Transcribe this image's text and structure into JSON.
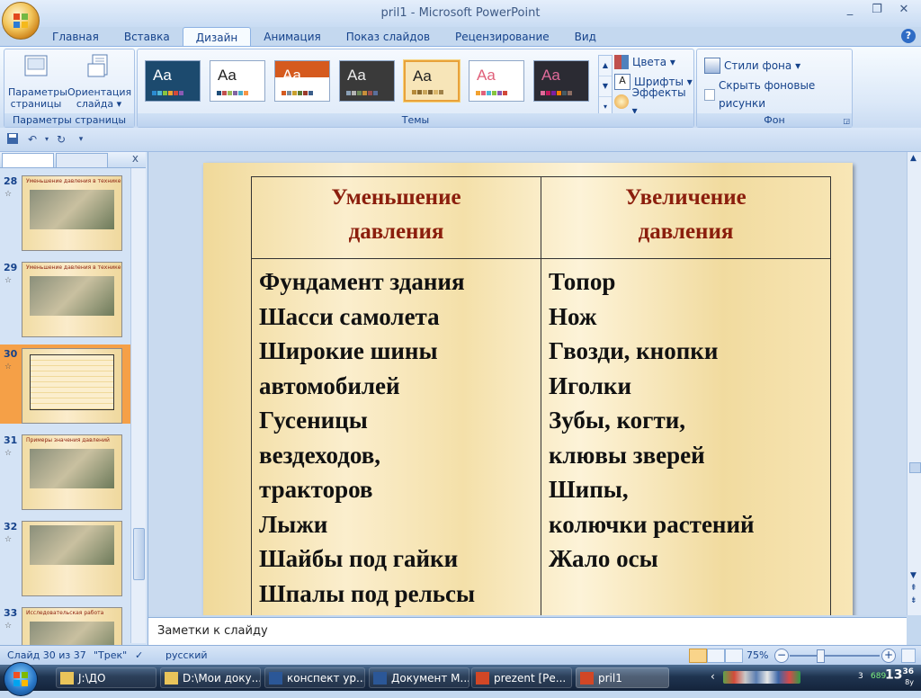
{
  "window": {
    "title": "pril1 - Microsoft PowerPoint",
    "controls": [
      "_",
      "❐",
      "✕"
    ]
  },
  "tabs": [
    "Главная",
    "Вставка",
    "Дизайн",
    "Анимация",
    "Показ слайдов",
    "Рецензирование",
    "Вид"
  ],
  "active_tab": "Дизайн",
  "ribbon": {
    "page_setup": {
      "params_label": "Параметры страницы",
      "orient_label": "Ориентация слайда ▾",
      "group_label": "Параметры страницы"
    },
    "themes": {
      "group_label": "Темы",
      "items": [
        {
          "aa": "Aa",
          "bg": "#1c4a6e",
          "fg": "#ffffff",
          "accents": [
            "#2b8bd0",
            "#4fb6d8",
            "#86c440",
            "#f2a230",
            "#d2483a",
            "#8a5ab4"
          ]
        },
        {
          "aa": "Aa",
          "bg": "#ffffff",
          "fg": "#222222",
          "accents": [
            "#1f4e79",
            "#c0504d",
            "#9bbb59",
            "#8064a2",
            "#4bacc6",
            "#f79646"
          ]
        },
        {
          "aa": "Aa",
          "bg": "#ffffff",
          "fg": "#ffffff",
          "accents": [
            "#d55a1e",
            "#7a8b9a",
            "#c8a02e",
            "#5c7a35",
            "#9a3b2b",
            "#3b5e8a"
          ]
        },
        {
          "aa": "Aa",
          "bg": "#3a3a3a",
          "fg": "#eeeeee",
          "accents": [
            "#8aa0b6",
            "#b3b3b3",
            "#6f8a5a",
            "#c98f3a",
            "#9b4f4f",
            "#5a6f9b"
          ]
        },
        {
          "aa": "Aa",
          "bg": "#f7e5b8",
          "fg": "#222222",
          "accents": [
            "#b58a3a",
            "#8a6a2e",
            "#c9a55a",
            "#7a5f30",
            "#d9b56a",
            "#a0824a"
          ]
        },
        {
          "aa": "Aa",
          "bg": "#ffffff",
          "fg": "#e0607a",
          "accents": [
            "#f2a230",
            "#e0607a",
            "#4fb6d8",
            "#86c440",
            "#8a5ab4",
            "#d2483a"
          ]
        },
        {
          "aa": "Aa",
          "bg": "#2b2b33",
          "fg": "#e06b9a",
          "accents": [
            "#e06b9a",
            "#c2185b",
            "#7b1fa2",
            "#f57c00",
            "#455a64",
            "#8d6e63"
          ]
        }
      ],
      "colors_label": "Цвета ▾",
      "fonts_label": "Шрифты ▾",
      "effects_label": "Эффекты ▾"
    },
    "background": {
      "styles_label": "Стили фона ▾",
      "hide_label": "Скрыть фоновые рисунки",
      "group_label": "Фон"
    }
  },
  "slides_pane": {
    "thumbnails": [
      {
        "num": "28",
        "title": "Уменьшение давления в технике"
      },
      {
        "num": "29",
        "title": "Уменьшение давления в технике"
      },
      {
        "num": "30",
        "title": "",
        "selected": true
      },
      {
        "num": "31",
        "title": "Примеры значения давлений"
      },
      {
        "num": "32",
        "title": ""
      },
      {
        "num": "33",
        "title": "Исследовательская работа"
      }
    ]
  },
  "slide": {
    "headers": [
      "Уменьшение давления",
      "Увеличение давления"
    ],
    "header_lines": [
      [
        "Уменьшение",
        "давления"
      ],
      [
        "Увеличение",
        "давления"
      ]
    ],
    "left_lines": [
      "Фундамент здания",
      "Шасси самолета",
      "Широкие шины",
      "автомобилей",
      "Гусеницы",
      "вездеходов,",
      "тракторов",
      "Лыжи",
      "Шайбы под гайки",
      "Шпалы под рельсы"
    ],
    "right_lines": [
      "Топор",
      "Нож",
      "Гвозди, кнопки",
      "Иголки",
      "Зубы, когти,",
      "клювы зверей",
      "Шипы,",
      "колючки растений",
      "Жало осы"
    ]
  },
  "notes": {
    "placeholder": "Заметки к слайду"
  },
  "status": {
    "slide_info": "Слайд 30 из 37",
    "theme": "\"Трек\"",
    "language": "русский",
    "zoom": "75%"
  },
  "taskbar": {
    "tasks": [
      {
        "label": "J:\\ДО",
        "icon": "folder-icon"
      },
      {
        "label": "D:\\Мои доку...",
        "icon": "folder-icon"
      },
      {
        "label": "конспект ур...",
        "icon": "word-icon"
      },
      {
        "label": "Документ М...",
        "icon": "word-icon"
      },
      {
        "label": "prezent [Ре...",
        "icon": "powerpoint-icon"
      },
      {
        "label": "pril1",
        "icon": "powerpoint-icon",
        "active": true
      }
    ],
    "tray_numbers": [
      "3",
      "689"
    ],
    "clock": {
      "hours": "13",
      "minutes": "36",
      "suffix": "8y"
    }
  }
}
